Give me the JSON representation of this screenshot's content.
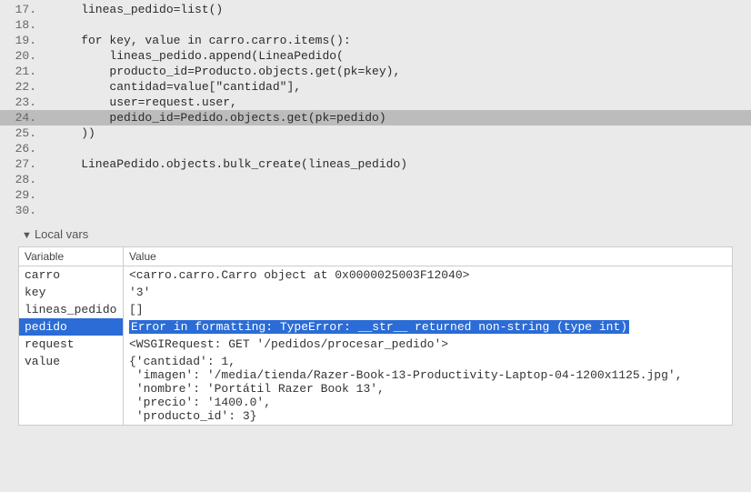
{
  "code": {
    "lines": [
      {
        "num": "17.",
        "text": "    lineas_pedido=list()",
        "hl": false
      },
      {
        "num": "18.",
        "text": "",
        "hl": false
      },
      {
        "num": "19.",
        "text": "    for key, value in carro.carro.items():",
        "hl": false
      },
      {
        "num": "20.",
        "text": "        lineas_pedido.append(LineaPedido(",
        "hl": false
      },
      {
        "num": "21.",
        "text": "        producto_id=Producto.objects.get(pk=key),",
        "hl": false
      },
      {
        "num": "22.",
        "text": "        cantidad=value[\"cantidad\"],",
        "hl": false
      },
      {
        "num": "23.",
        "text": "        user=request.user,",
        "hl": false
      },
      {
        "num": "24.",
        "text": "        pedido_id=Pedido.objects.get(pk=pedido)",
        "hl": true
      },
      {
        "num": "25.",
        "text": "    ))",
        "hl": false
      },
      {
        "num": "26.",
        "text": "",
        "hl": false
      },
      {
        "num": "27.",
        "text": "    LineaPedido.objects.bulk_create(lineas_pedido)",
        "hl": false
      },
      {
        "num": "28.",
        "text": "",
        "hl": false
      },
      {
        "num": "29.",
        "text": "",
        "hl": false
      },
      {
        "num": "30.",
        "text": "",
        "hl": false
      }
    ]
  },
  "local_vars": {
    "header": "Local vars",
    "columns": {
      "variable": "Variable",
      "value": "Value"
    },
    "rows": [
      {
        "name": "carro",
        "value": "<carro.carro.Carro object at 0x0000025003F12040>",
        "selected": false,
        "is_error": false
      },
      {
        "name": "key",
        "value": "'3'",
        "selected": false,
        "is_error": false
      },
      {
        "name": "lineas_pedido",
        "value": "[]",
        "selected": false,
        "is_error": false
      },
      {
        "name": "pedido",
        "value": "Error in formatting: TypeError: __str__ returned non-string (type int)",
        "selected": true,
        "is_error": true
      },
      {
        "name": "request",
        "value": "<WSGIRequest: GET '/pedidos/procesar_pedido'>",
        "selected": false,
        "is_error": false
      },
      {
        "name": "value",
        "value": "{'cantidad': 1,\n 'imagen': '/media/tienda/Razer-Book-13-Productivity-Laptop-04-1200x1125.jpg',\n 'nombre': 'Portátil Razer Book 13',\n 'precio': '1400.0',\n 'producto_id': 3}",
        "selected": false,
        "is_error": false
      }
    ]
  }
}
